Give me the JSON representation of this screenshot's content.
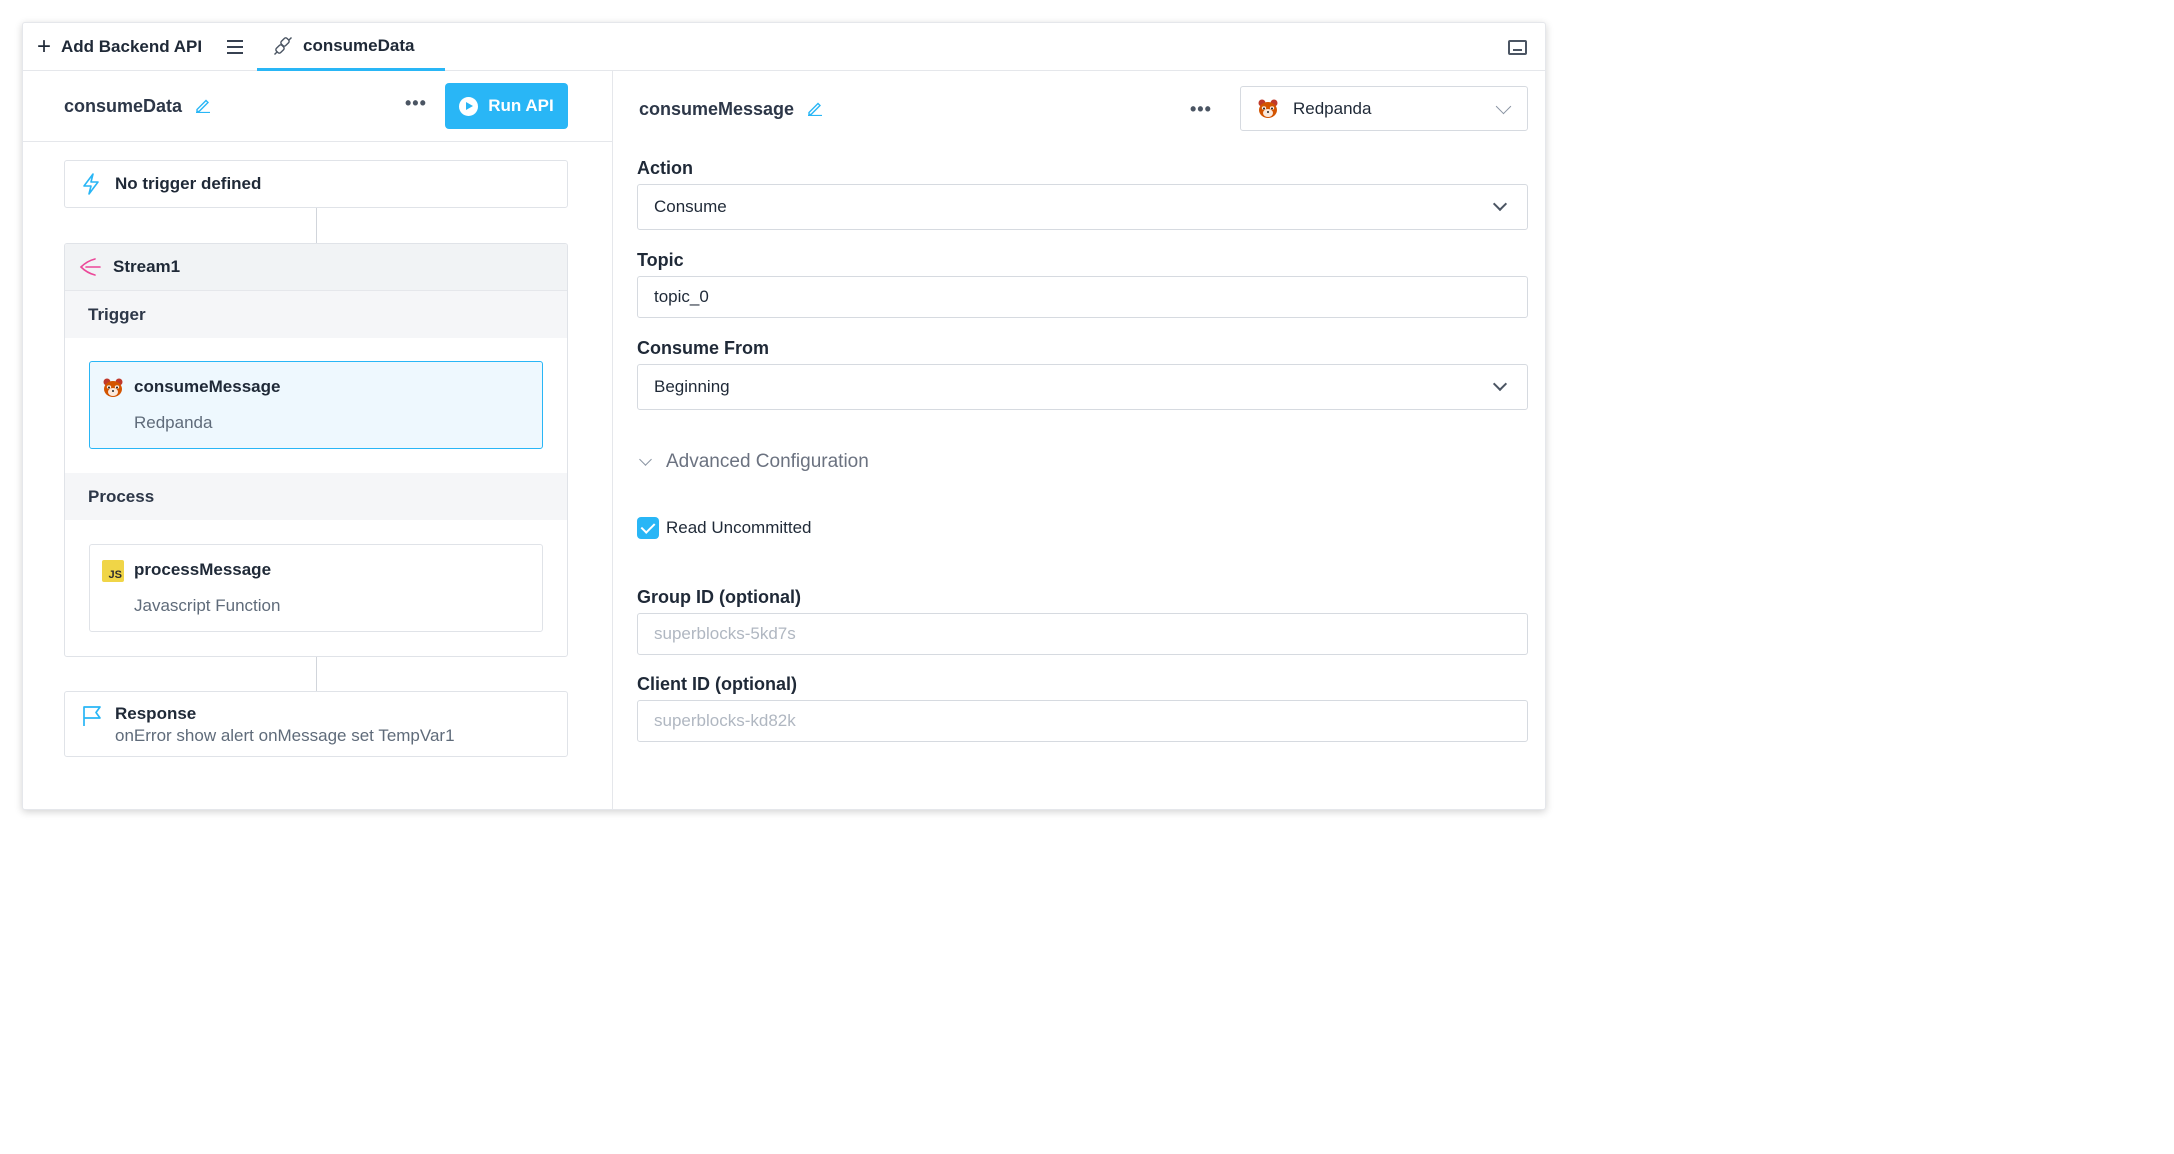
{
  "header": {
    "add_label": "Add Backend API",
    "tab_label": "consumeData"
  },
  "left": {
    "api_name": "consumeData",
    "run_label": "Run API",
    "trigger_label": "No trigger defined",
    "stream": {
      "name": "Stream1",
      "trigger_section": "Trigger",
      "trigger_step": {
        "name": "consumeMessage",
        "integration": "Redpanda"
      },
      "process_section": "Process",
      "process_step": {
        "name": "processMessage",
        "integration": "Javascript Function",
        "icon_text": "JS"
      }
    },
    "response": {
      "title": "Response",
      "detail": "onError show alert onMessage set TempVar1"
    }
  },
  "right": {
    "step_title": "consumeMessage",
    "integration": "Redpanda",
    "action_label": "Action",
    "action_value": "Consume",
    "topic_label": "Topic",
    "topic_value": "topic_0",
    "consume_from_label": "Consume From",
    "consume_from_value": "Beginning",
    "advanced_label": "Advanced Configuration",
    "read_uncommitted_label": "Read Uncommitted",
    "read_uncommitted_checked": true,
    "group_id_label": "Group ID (optional)",
    "group_id_placeholder": "superblocks-5kd7s",
    "client_id_label": "Client ID (optional)",
    "client_id_placeholder": "superblocks-kd82k"
  },
  "colors": {
    "accent": "#29b6f6",
    "stream_icon": "#ec4899"
  }
}
